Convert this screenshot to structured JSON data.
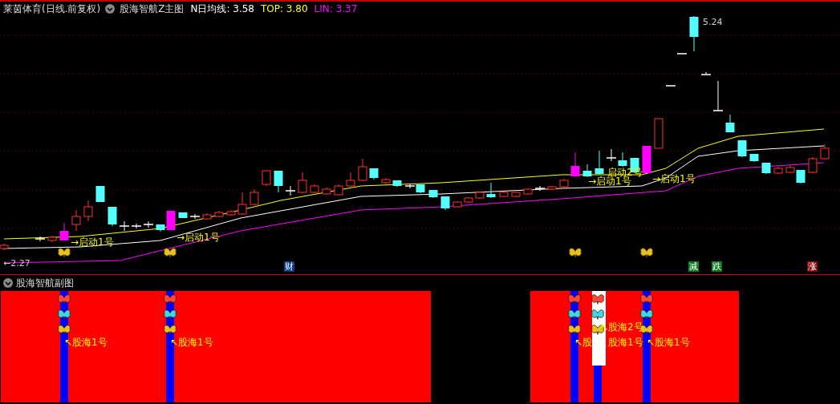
{
  "header": {
    "stock": "莱茵体育(日线.前复权)",
    "indicator": "股海智航Z主图",
    "readings": [
      {
        "text": "N日均线: 3.58",
        "color": "#ffffff"
      },
      {
        "text": "TOP: 3.80",
        "color": "#ffff00"
      },
      {
        "text": "LIN: 3.37",
        "color": "#ff00ff"
      }
    ]
  },
  "main_chart": {
    "high_label": "5.24",
    "low_label": "←2.27",
    "signals": [
      "→启动1号",
      "→启动1号",
      "→启动1号",
      "启动2号",
      "→启动1号"
    ],
    "markers": [
      {
        "text": "财",
        "color": "#0a3a8a"
      },
      {
        "text": "减",
        "color": "#0a7a1a"
      },
      {
        "text": "跌",
        "color": "#0a7a1a"
      },
      {
        "text": "涨",
        "color": "#8a0a0a"
      }
    ]
  },
  "sub_chart": {
    "title": "股海智航副图",
    "labels": [
      "↖股海2号",
      "↖股海1号",
      "↖股海1号",
      "↖股",
      "股海1号",
      "↖股海1号"
    ]
  }
}
